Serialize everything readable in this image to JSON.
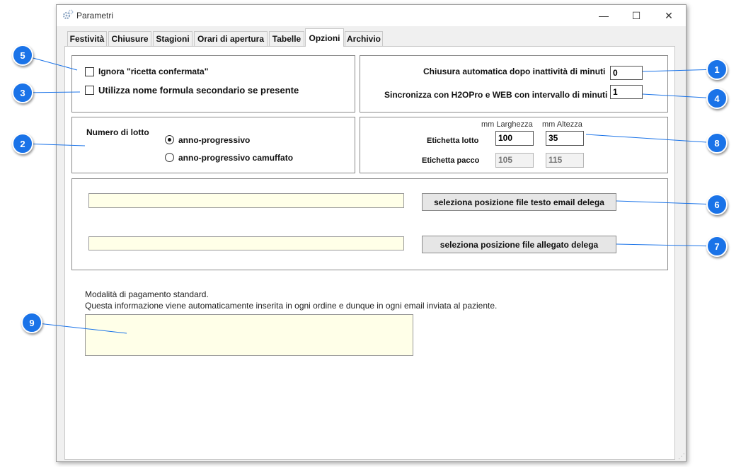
{
  "window": {
    "title": "Parametri",
    "icon": "gear-icon"
  },
  "window_controls": {
    "minimize": "—",
    "maximize": "☐",
    "close": "✕"
  },
  "tabs": [
    {
      "label": "Festività"
    },
    {
      "label": "Chiusure"
    },
    {
      "label": "Stagioni"
    },
    {
      "label": "Orari di apertura"
    },
    {
      "label": "Tabelle"
    },
    {
      "label": "Opzioni"
    },
    {
      "label": "Archivio"
    }
  ],
  "active_tab": "Opzioni",
  "options": {
    "ignore_label": "Ignora \"ricetta confermata\"",
    "use_secondary_label": "Utilizza nome formula secondario se presente"
  },
  "auto_close": {
    "label": "Chiusura automatica dopo inattività di minuti",
    "value": "0"
  },
  "sync": {
    "label": "Sincronizza con H2OPro e WEB con intervallo di minuti",
    "value": "1"
  },
  "lot": {
    "label": "Numero di lotto",
    "option1": "anno-progressivo",
    "option2": "anno-progressivo camuffato",
    "selected": "anno-progressivo"
  },
  "labels": {
    "width_header": "mm Larghezza",
    "height_header": "mm Altezza",
    "lot_label": "Etichetta lotto",
    "lot_width": "100",
    "lot_height": "35",
    "pack_label": "Etichetta pacco",
    "pack_width": "105",
    "pack_height": "115"
  },
  "files": {
    "email_button": "seleziona posizione file testo email delega",
    "attachment_button": "seleziona posizione file allegato delega"
  },
  "payment": {
    "line1": "Modalità di pagamento standard.",
    "line2": "Questa informazione viene automaticamente inserita in ogni ordine e dunque in ogni email inviata al paziente."
  },
  "callouts": {
    "c1": "1",
    "c2": "2",
    "c3": "3",
    "c4": "4",
    "c5": "5",
    "c6": "6",
    "c7": "7",
    "c8": "8",
    "c9": "9"
  },
  "colors": {
    "callout": "#1a73e8",
    "field_yellow": "#ffffe8"
  }
}
